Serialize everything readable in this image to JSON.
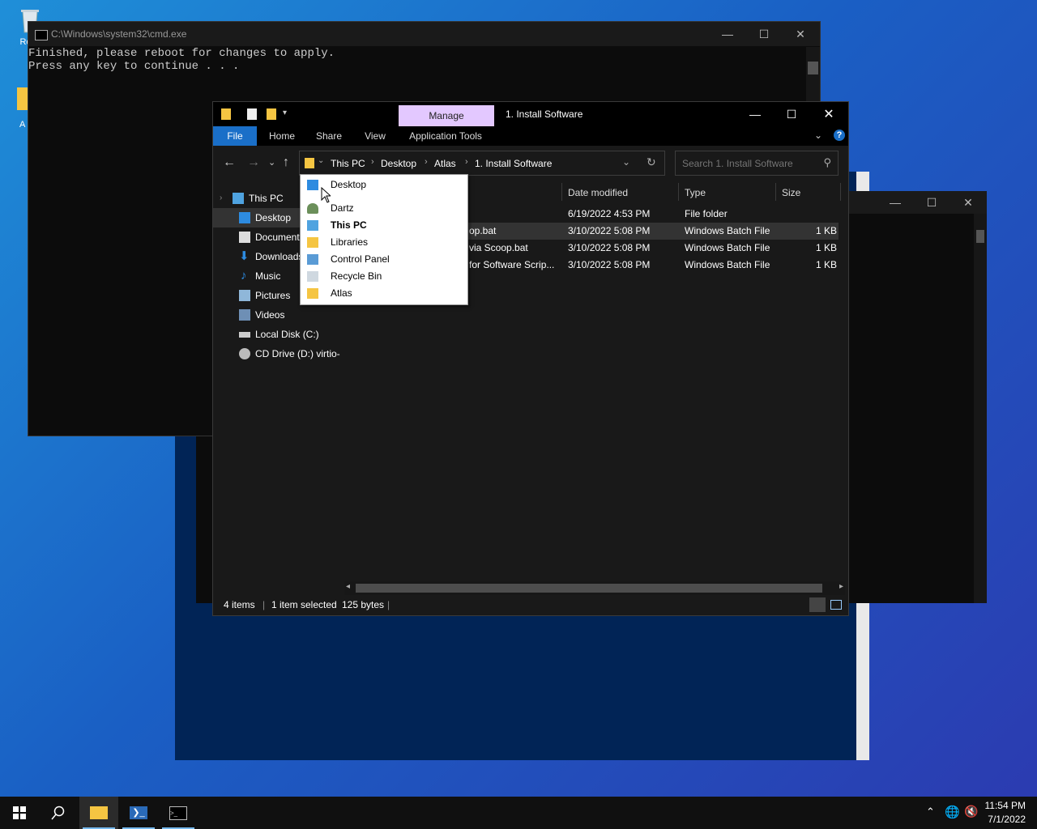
{
  "desktop": {
    "icons": [
      {
        "label": "Recycle Bin",
        "visible_label": "Recy"
      },
      {
        "label": "Atlas",
        "visible_label": "A"
      }
    ]
  },
  "cmd": {
    "title": "C:\\Windows\\system32\\cmd.exe",
    "lines": [
      "Finished, please reboot for changes to apply.",
      "Press any key to continue . . ."
    ]
  },
  "explorer": {
    "context_tab": "Manage",
    "title": "1. Install Software",
    "ribbon_tabs": [
      "File",
      "Home",
      "Share",
      "View",
      "Application Tools"
    ],
    "breadcrumb": [
      "This PC",
      "Desktop",
      "Atlas",
      "1. Install Software"
    ],
    "search_placeholder": "Search 1. Install Software",
    "nav": [
      "This PC",
      "Desktop",
      "Documents",
      "Downloads",
      "Music",
      "Pictures",
      "Videos",
      "Local Disk (C:)",
      "CD Drive (D:) virtio-"
    ],
    "columns": {
      "date": "Date modified",
      "type": "Type",
      "size": "Size"
    },
    "rows": [
      {
        "name": "",
        "date": "6/19/2022 4:53 PM",
        "type": "File folder",
        "size": ""
      },
      {
        "name": "op.bat",
        "date": "3/10/2022 5:08 PM",
        "type": "Windows Batch File",
        "size": "1 KB"
      },
      {
        "name": "via Scoop.bat",
        "date": "3/10/2022 5:08 PM",
        "type": "Windows Batch File",
        "size": "1 KB"
      },
      {
        "name": "for Software Scrip...",
        "date": "3/10/2022 5:08 PM",
        "type": "Windows Batch File",
        "size": "1 KB"
      }
    ],
    "status": {
      "count": "4 items",
      "selection": "1 item selected",
      "size": "125 bytes"
    }
  },
  "dropdown": {
    "items": [
      "Desktop",
      "Dartz",
      "This PC",
      "Libraries",
      "Control Panel",
      "Recycle Bin",
      "Atlas"
    ]
  },
  "taskbar": {
    "time": "11:54 PM",
    "date": "7/1/2022"
  },
  "colors": {
    "accent": "#1a6fc8",
    "manage_tab": "#e3c8ff",
    "folder": "#f5c542"
  }
}
